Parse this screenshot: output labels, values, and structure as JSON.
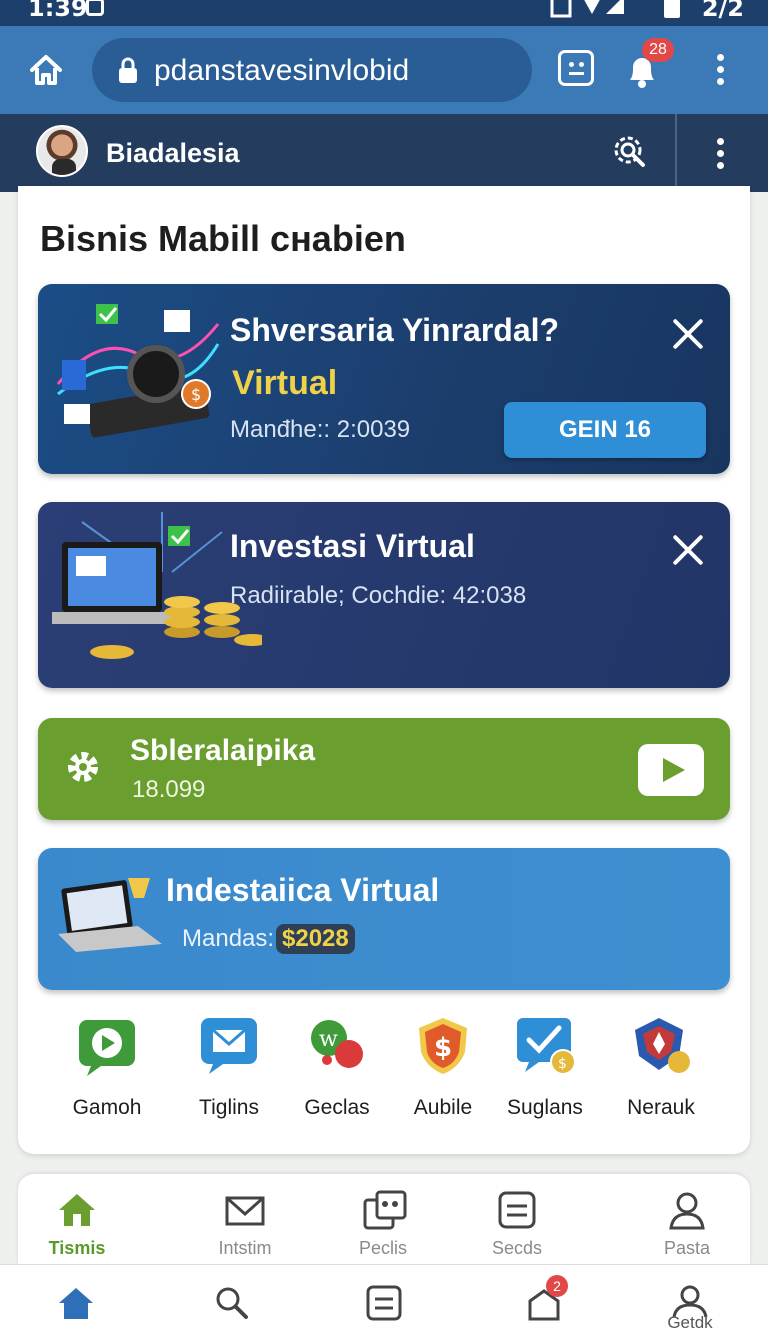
{
  "status_bar": {
    "time": "1:39",
    "right_text": "2/2"
  },
  "browser": {
    "url": "pdanstavesinvlobid",
    "notification_count": "28"
  },
  "app_bar": {
    "title": "Biadalesia"
  },
  "page": {
    "title": "Bisnis Mabill cнabien"
  },
  "promos": [
    {
      "title": "Shversaria Yinrardal?",
      "accent": "Virtual",
      "subtitle": "Manđhe:: 2:0039",
      "button": "GEIN 16"
    },
    {
      "title": "Investasi Virtual",
      "subtitle": "Radiirable; Cochdie: 42:038"
    },
    {
      "title": "Sbleralaipika",
      "subtitle": "18.099"
    },
    {
      "title": "Indestaiica Virtual",
      "price_label": "Mandas:",
      "price": "$2028"
    }
  ],
  "shortcuts": [
    {
      "label": "Gamoh",
      "icon": "play-chat-icon",
      "color": "#3f9a3a"
    },
    {
      "label": "Tiglins",
      "icon": "mail-chat-icon",
      "color": "#2f8fd6"
    },
    {
      "label": "Geclas",
      "icon": "ball-icon",
      "color": "#d93a3a"
    },
    {
      "label": "Aubile",
      "icon": "dollar-shield-icon",
      "color": "#e05a2a"
    },
    {
      "label": "Suglans",
      "icon": "check-coin-icon",
      "color": "#2f8fd6"
    },
    {
      "label": "Nerauk",
      "icon": "gem-shield-icon",
      "color": "#c33a3a"
    }
  ],
  "tabs": [
    {
      "label": "Tismis",
      "icon": "home-icon",
      "active": true
    },
    {
      "label": "Intstim",
      "icon": "mail-icon"
    },
    {
      "label": "Peclis",
      "icon": "puzzle-icon"
    },
    {
      "label": "Secds",
      "icon": "list-icon"
    },
    {
      "label": "Pasta",
      "icon": "user-icon"
    }
  ],
  "nav": [
    {
      "icon": "home-icon"
    },
    {
      "icon": "search-icon"
    },
    {
      "icon": "list-icon"
    },
    {
      "icon": "cart-icon",
      "badge": "2"
    },
    {
      "icon": "user-icon",
      "label": "Getdk"
    }
  ],
  "colors": {
    "accent_green": "#6a9e2e",
    "accent_blue": "#3b79b7",
    "badge_red": "#e24848"
  }
}
